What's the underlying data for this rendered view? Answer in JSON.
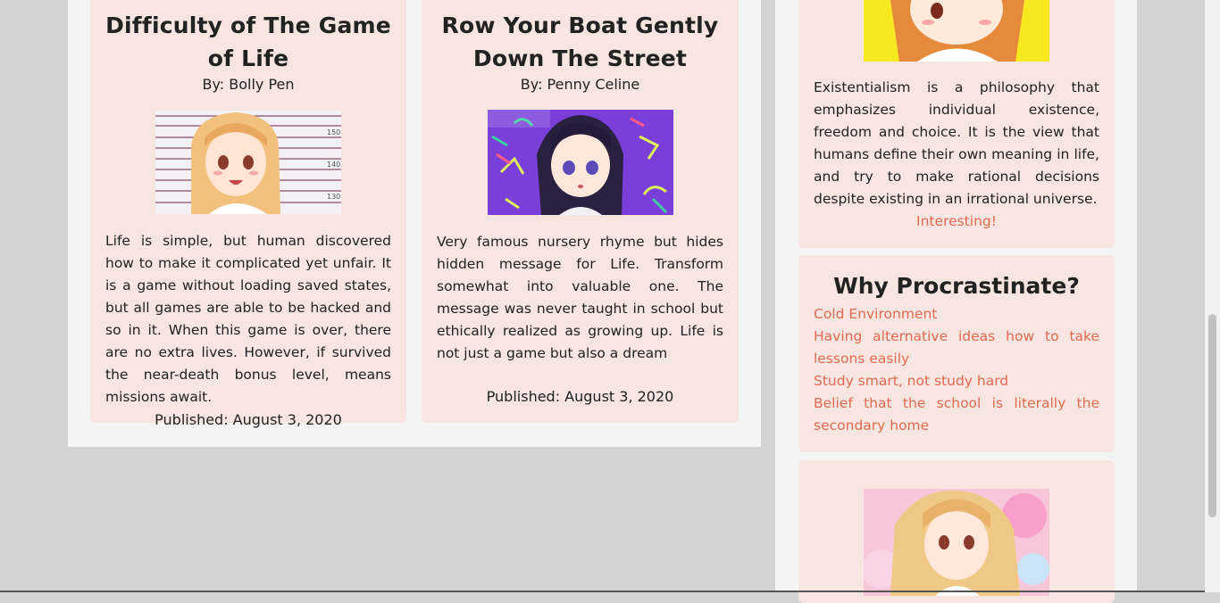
{
  "posts": [
    {
      "title": "Difficulty of The Game of Life",
      "author": "By: Bolly Pen",
      "text": "Life is simple, but human discovered how to make it complicated yet unfair. It is a game without loading saved states, but all games are able to be hacked and so in it. When this game is over, there are no extra lives. However, if survived the near-death bonus level, means missions await.",
      "date": "Published: August 3, 2020",
      "image": "anime-girl-height-chart-image"
    },
    {
      "title": "Row Your Boat Gently Down The Street",
      "author": "By: Penny Celine",
      "text": "Very famous nursery rhyme but hides hidden message for Life. Transform somewhat into valuable one. The message was never taught in school but ethically realized as growing up. Life is not just a game but also a dream",
      "date": "Published: August 3, 2020",
      "image": "anime-girl-purple-background-image"
    }
  ],
  "sidebar": {
    "existentialism": {
      "text": "Existentialism is a philosophy that emphasizes individual existence, freedom and choice. It is the view that humans define their own meaning in life, and try to make rational decisions despite existing in an irrational universe.",
      "link": "Interesting!"
    },
    "procrastinate": {
      "title": "Why Procrastinate?",
      "reasons": [
        "Cold Environment",
        "Having alternative ideas how to take lessons easily",
        "Study smart, not study hard",
        "Belief that the school is literally the secondary home"
      ]
    }
  },
  "colors": {
    "accent": "#e06a50",
    "card": "#f6e5e1",
    "page": "#d3d3d3"
  }
}
